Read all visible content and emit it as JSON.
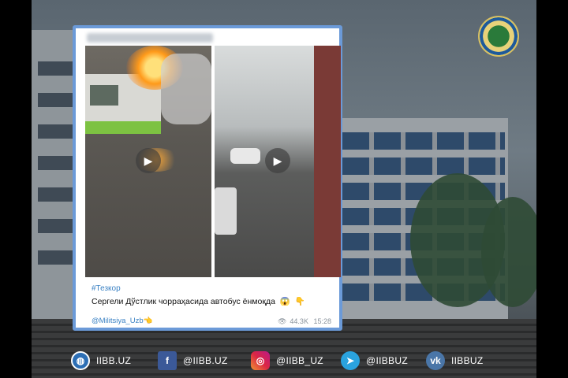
{
  "post": {
    "hashtag": "#Тезкор",
    "caption": "Сергели Дўстлик чорраҳасида автобус ёнмоқда",
    "caption_emojis": [
      "😱",
      "👇"
    ],
    "author": "@Militsiya_Uzb",
    "author_emoji": "👈",
    "views": "44.3K",
    "time": "15:28"
  },
  "social": [
    {
      "icon": "globe-icon",
      "label": "IIBB.UZ",
      "color": "#2d6fb5"
    },
    {
      "icon": "facebook-icon",
      "label": "@IIBB.UZ",
      "color": "#3b5998"
    },
    {
      "icon": "instagram-icon",
      "label": "@IIBB_UZ",
      "color": "#d6249f"
    },
    {
      "icon": "telegram-icon",
      "label": "@IIBBUZ",
      "color": "#2aa3df"
    },
    {
      "icon": "vk-icon",
      "label": "IIBBUZ",
      "color": "#4a76a8"
    }
  ]
}
